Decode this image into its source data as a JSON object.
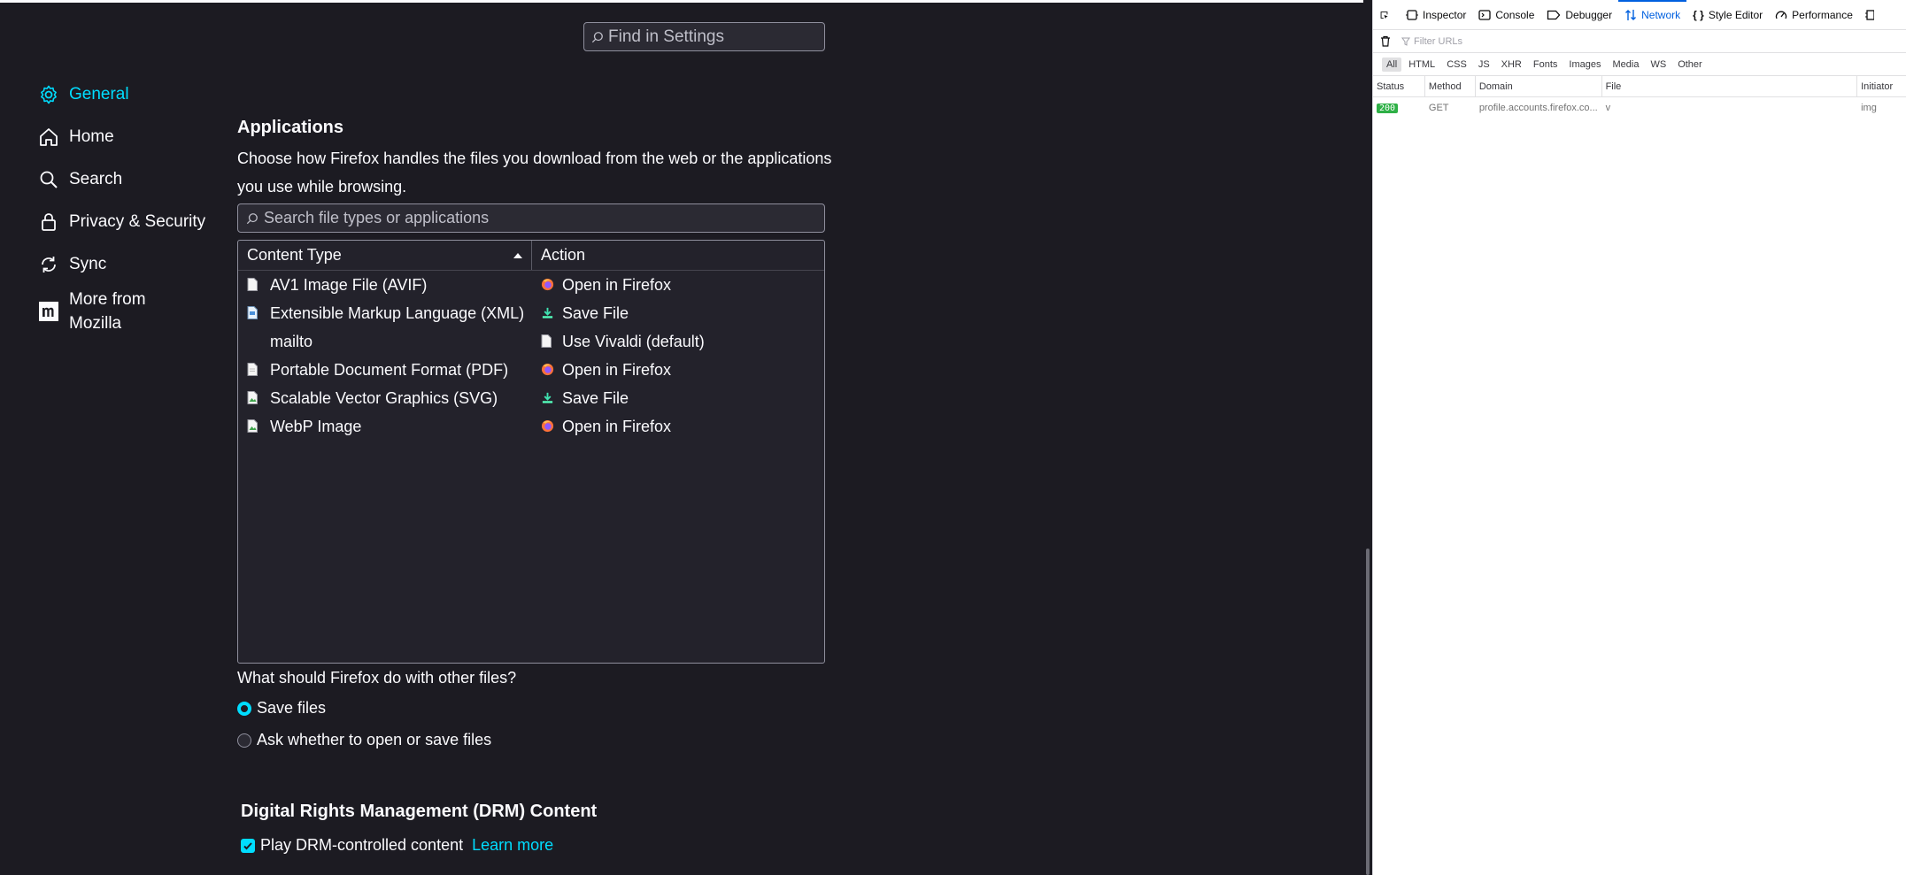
{
  "settings": {
    "find_placeholder": "Find in Settings",
    "nav": [
      {
        "label": "General",
        "icon": "gear-icon",
        "active": true
      },
      {
        "label": "Home",
        "icon": "home-icon"
      },
      {
        "label": "Search",
        "icon": "search-icon"
      },
      {
        "label": "Privacy & Security",
        "icon": "lock-icon"
      },
      {
        "label": "Sync",
        "icon": "sync-icon"
      },
      {
        "label": "More from Mozilla",
        "icon": "mozilla-icon"
      }
    ],
    "applications": {
      "title": "Applications",
      "description": "Choose how Firefox handles the files you download from the web or the applications you use while browsing.",
      "search_placeholder": "Search file types or applications",
      "col_content_type": "Content Type",
      "col_action": "Action",
      "rows": [
        {
          "type": "AV1 Image File (AVIF)",
          "action": "Open in Firefox",
          "action_icon": "firefox-icon"
        },
        {
          "type": "Extensible Markup Language (XML)",
          "action": "Save File",
          "action_icon": "download-icon"
        },
        {
          "type": "mailto",
          "action": "Use Vivaldi (default)",
          "action_icon": "document-icon"
        },
        {
          "type": "Portable Document Format (PDF)",
          "action": "Open in Firefox",
          "action_icon": "firefox-icon"
        },
        {
          "type": "Scalable Vector Graphics (SVG)",
          "action": "Save File",
          "action_icon": "download-icon"
        },
        {
          "type": "WebP Image",
          "action": "Open in Firefox",
          "action_icon": "firefox-icon"
        }
      ],
      "other_files_question": "What should Firefox do with other files?",
      "option_save": "Save files",
      "option_ask": "Ask whether to open or save files",
      "selected_option": "save"
    },
    "drm": {
      "title": "Digital Rights Management (DRM) Content",
      "checkbox_label": "Play DRM-controlled content",
      "checked": true,
      "learn_more": "Learn more"
    }
  },
  "devtools": {
    "tabs": [
      {
        "label": "Inspector",
        "icon": "inspector-icon"
      },
      {
        "label": "Console",
        "icon": "console-icon"
      },
      {
        "label": "Debugger",
        "icon": "debugger-icon"
      },
      {
        "label": "Network",
        "icon": "network-icon",
        "selected": true
      },
      {
        "label": "Style Editor",
        "icon": "style-editor-icon"
      },
      {
        "label": "Performance",
        "icon": "performance-icon"
      }
    ],
    "filter_placeholder": "Filter URLs",
    "types": [
      "All",
      "HTML",
      "CSS",
      "JS",
      "XHR",
      "Fonts",
      "Images",
      "Media",
      "WS",
      "Other"
    ],
    "selected_type": "All",
    "columns": [
      "Status",
      "Method",
      "Domain",
      "File",
      "Initiator"
    ],
    "requests": [
      {
        "status": "200",
        "method": "GET",
        "domain": "profile.accounts.firefox.co...",
        "file": "v",
        "initiator": "img"
      }
    ]
  },
  "colors": {
    "accent": "#00ddff",
    "background": "#1c1b22",
    "devtools_selected": "#0060df",
    "status_ok": "#2eb046"
  }
}
